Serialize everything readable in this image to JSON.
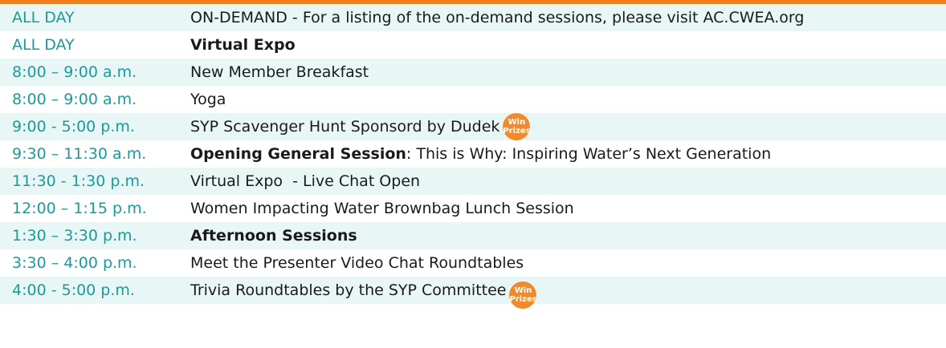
{
  "colors": {
    "accent_bar": "#f07d1e",
    "time_text": "#1a9b9b",
    "stripe": "#e8f6f6",
    "badge": "#f28a2b"
  },
  "badge": {
    "line1": "Win",
    "line2": "Prizes"
  },
  "schedule": [
    {
      "time": "ALL DAY",
      "bold": "",
      "text": "ON-DEMAND - For a listing of the on-demand sessions, please visit AC.CWEA.org"
    },
    {
      "time": "ALL DAY",
      "bold": "Virtual Expo",
      "text": ""
    },
    {
      "time": "8:00 – 9:00 a.m.",
      "bold": "",
      "text": "New Member Breakfast"
    },
    {
      "time": "8:00 – 9:00 a.m.",
      "bold": "",
      "text": "Yoga"
    },
    {
      "time": "9:00 - 5:00 p.m.",
      "bold": "",
      "text": "SYP Scavenger Hunt Sponsord by Dudek"
    },
    {
      "time": "9:30 – 11:30 a.m.",
      "bold": "Opening General Session",
      "text": ": This is Why: Inspiring Water’s Next Generation"
    },
    {
      "time": "11:30 - 1:30 p.m.",
      "bold": "",
      "text": "Virtual Expo  - Live Chat Open"
    },
    {
      "time": "12:00 – 1:15 p.m.",
      "bold": "",
      "text": "Women Impacting Water Brownbag Lunch Session"
    },
    {
      "time": "1:30 – 3:30 p.m.",
      "bold": "Afternoon Sessions",
      "text": ""
    },
    {
      "time": "3:30 – 4:00 p.m.",
      "bold": "",
      "text": "Meet the Presenter Video Chat Roundtables"
    },
    {
      "time": "4:00 - 5:00 p.m.",
      "bold": "",
      "text": "Trivia Roundtables by the SYP Committee"
    }
  ]
}
